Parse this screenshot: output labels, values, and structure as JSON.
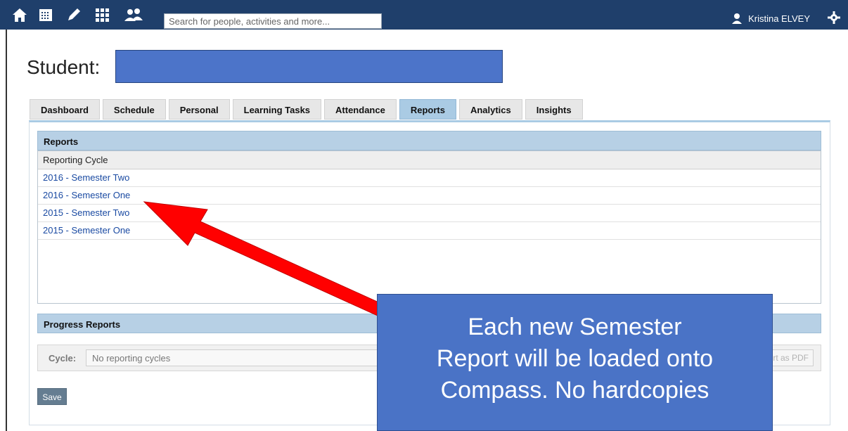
{
  "topbar": {
    "icons": [
      "home-icon",
      "calendar-icon",
      "pencil-icon",
      "grid-icon",
      "people-icon"
    ],
    "search_placeholder": "Search for people, activities and more...",
    "user_name": "Kristina ELVEY",
    "user_icon": "user-icon",
    "settings_icon": "gear-icon"
  },
  "page": {
    "title": "Student:",
    "redaction_color": "#4c74c9"
  },
  "tabs": [
    {
      "label": "Dashboard"
    },
    {
      "label": "Schedule"
    },
    {
      "label": "Personal"
    },
    {
      "label": "Learning Tasks"
    },
    {
      "label": "Attendance"
    },
    {
      "label": "Reports",
      "active": true
    },
    {
      "label": "Analytics"
    },
    {
      "label": "Insights"
    }
  ],
  "reports": {
    "header": "Reports",
    "column_header": "Reporting Cycle",
    "rows": [
      "2016 - Semester Two",
      "2016 - Semester One",
      "2015 - Semester Two",
      "2015 - Semester One"
    ]
  },
  "progress_reports": {
    "header": "Progress Reports",
    "cycle_label": "Cycle:",
    "cycle_value": "No reporting cycles",
    "pdf_button": "rt as PDF"
  },
  "save_button": "Save",
  "callout": {
    "lines": [
      "Each new Semester",
      "Report will be loaded onto",
      "Compass. No hardcopies"
    ],
    "color": "#4a73c6",
    "arrow_color": "#ff0000"
  }
}
